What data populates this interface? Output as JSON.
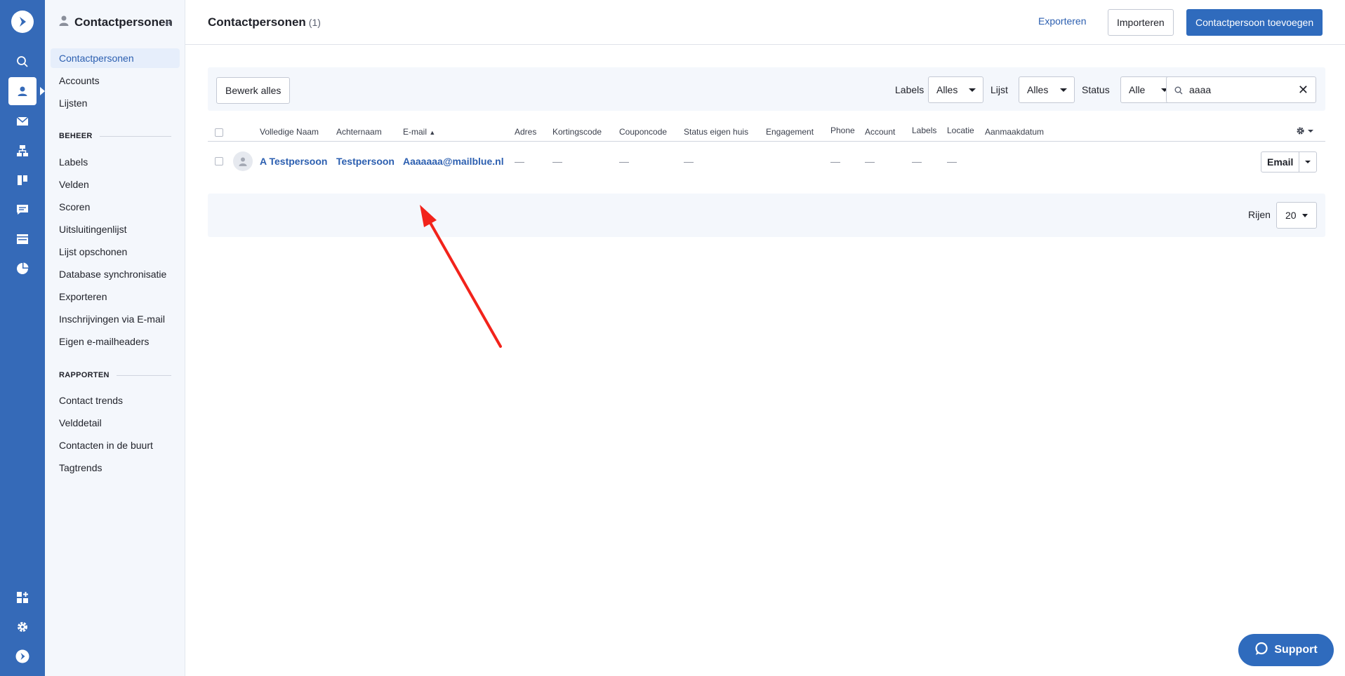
{
  "sidebar": {
    "title": "Contactpersonen",
    "items": [
      "Contactpersonen",
      "Accounts",
      "Lijsten"
    ],
    "beheer_label": "BEHEER",
    "beheer_items": [
      "Labels",
      "Velden",
      "Scoren",
      "Uitsluitingenlijst",
      "Lijst opschonen",
      "Database synchronisatie",
      "Exporteren",
      "Inschrijvingen via E-mail",
      "Eigen e-mailheaders"
    ],
    "rapporten_label": "RAPPORTEN",
    "rapporten_items": [
      "Contact trends",
      "Velddetail",
      "Contacten in de buurt",
      "Tagtrends"
    ]
  },
  "header": {
    "title": "Contactpersonen",
    "count": "(1)",
    "export_label": "Exporteren",
    "import_label": "Importeren",
    "add_label": "Contactpersoon toevoegen"
  },
  "filters": {
    "edit_all_label": "Bewerk alles",
    "labels_label": "Labels",
    "labels_value": "Alles",
    "list_label": "Lijst",
    "list_value": "Alles",
    "status_label": "Status",
    "status_value": "Alle",
    "search_value": "aaaa"
  },
  "table": {
    "columns": [
      "Volledige Naam",
      "Achternaam",
      "E-mail",
      "Adres",
      "Kortingscode",
      "Couponcode",
      "Status eigen huis",
      "Engagement",
      "Phone",
      "Account",
      "Labels",
      "Locatie",
      "Aanmaakdatum"
    ],
    "row": {
      "full_name": "A Testpersoon",
      "last_name": "Testpersoon",
      "email": "Aaaaaaa@mailblue.nl",
      "dash": "—",
      "action_label": "Email"
    }
  },
  "pagination": {
    "rows_label": "Rijen",
    "rows_value": "20"
  },
  "support": {
    "label": "Support"
  },
  "colors": {
    "rail": "#356ab8",
    "accent": "#2f6bbd",
    "annotation_arrow": "#f2231b"
  }
}
